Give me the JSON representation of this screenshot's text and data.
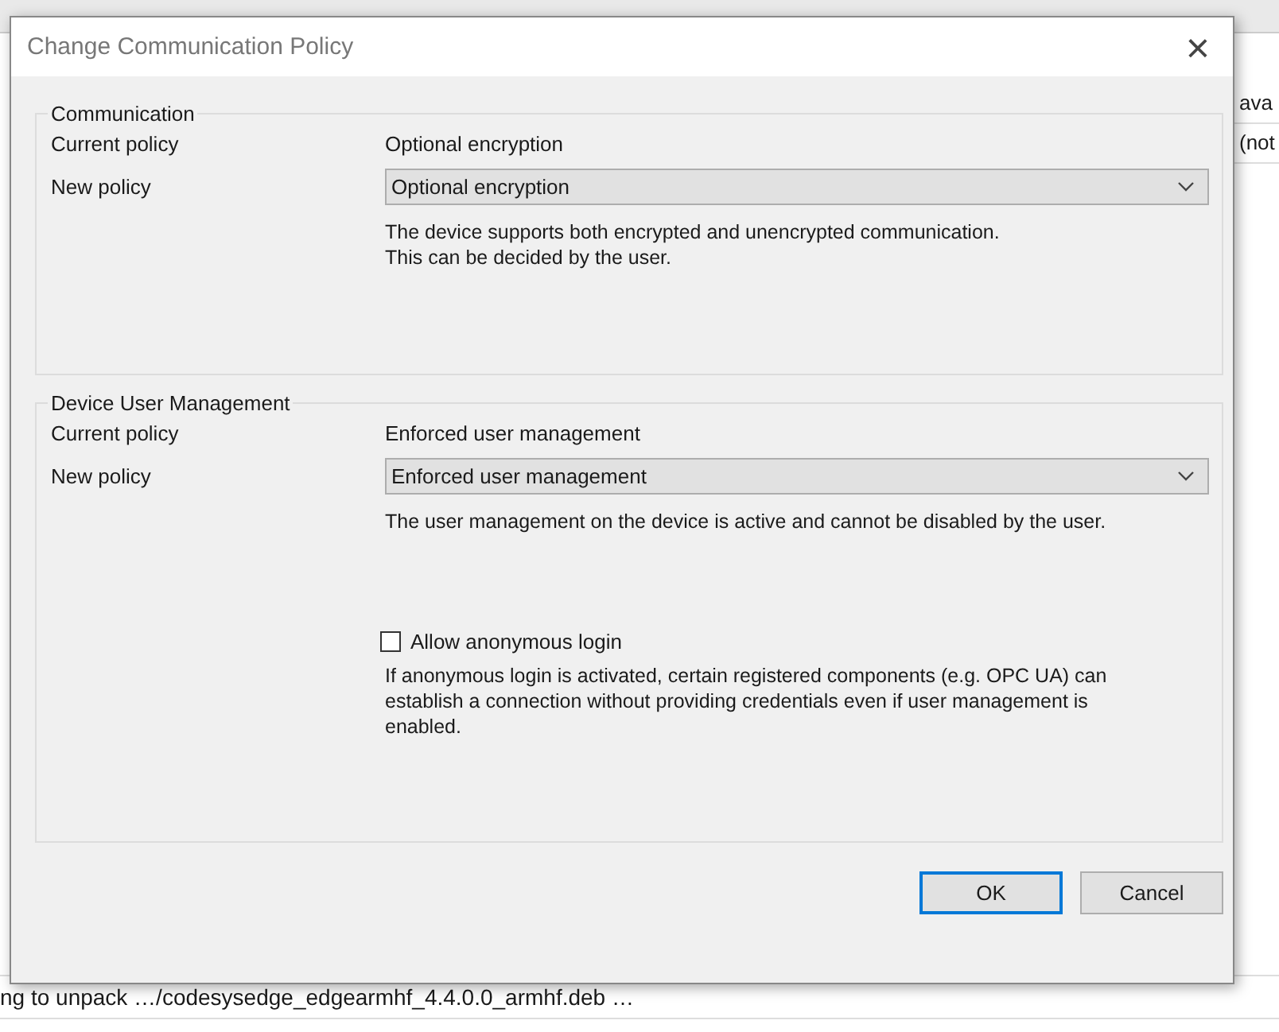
{
  "background": {
    "right_fragments": [
      "ava",
      "(not"
    ],
    "log_line": "ng to unpack …/codesysedge_edgearmhf_4.4.0.0_armhf.deb …"
  },
  "dialog": {
    "title": "Change Communication Policy",
    "close": "×",
    "groups": [
      {
        "title": "Communication",
        "current_label": "Current policy",
        "current_value": "Optional encryption",
        "new_label": "New policy",
        "new_value": "Optional encryption",
        "description": [
          "The device supports both encrypted and unencrypted communication.",
          "This can be decided by the user."
        ]
      },
      {
        "title": "Device User Management",
        "current_label": "Current policy",
        "current_value": "Enforced user management",
        "new_label": "New policy",
        "new_value": "Enforced user management",
        "description": [
          "The user management on the device is active and cannot be disabled by the user."
        ],
        "option": {
          "label": "Allow anonymous login",
          "checked": false,
          "description": "If anonymous login is activated, certain registered components (e.g. OPC UA) can establish a connection without providing credentials even if user management is enabled."
        }
      }
    ],
    "buttons": [
      {
        "label": "OK",
        "kind": "default"
      },
      {
        "label": "Cancel",
        "kind": "normal"
      }
    ]
  }
}
